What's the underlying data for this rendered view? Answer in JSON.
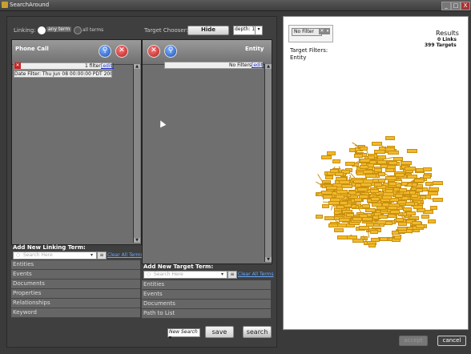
{
  "window": {
    "title": "SearchAround",
    "minimize": "_",
    "maximize": "□",
    "close": "X"
  },
  "linking": {
    "label": "Linking:",
    "any_term": "any term",
    "all_terms": "all terms"
  },
  "target_chooser": {
    "label": "Target Chooser:",
    "hide_button": "Hide",
    "depth_value": "depth: 1"
  },
  "left_column": {
    "title": "Phone Call",
    "filter_count": "1  filter",
    "edit_link": "[edit]",
    "date_filter": "Date Filter: Thu Jun 08 00:00:00 PDT 200...",
    "add_label": "Add New Linking Term:",
    "search_placeholder": "Search Here",
    "clear_all": "Clear All Terms",
    "categories": [
      "Entities",
      "Events",
      "Documents",
      "Properties",
      "Relationships",
      "Keyword"
    ]
  },
  "right_column": {
    "title": "Entity",
    "no_filters": "No Filters",
    "edit_link": "[edit]",
    "add_label": "Add New Target Term:",
    "search_placeholder": "Search Here",
    "clear_all": "Clear All Terms",
    "categories": [
      "Entities",
      "Events",
      "Documents",
      "Path to List"
    ]
  },
  "bottom": {
    "new_search": "New Search",
    "save": "save",
    "search": "search"
  },
  "results": {
    "filter_select": "No Filter",
    "title": "Results",
    "links": "0 Links",
    "targets": "399 Targets",
    "target_filters_label": "Target Filters:",
    "target_filters_value": "Entity",
    "node_color": "#f0b92a"
  },
  "footer": {
    "accept": "accept",
    "cancel": "cancel"
  }
}
